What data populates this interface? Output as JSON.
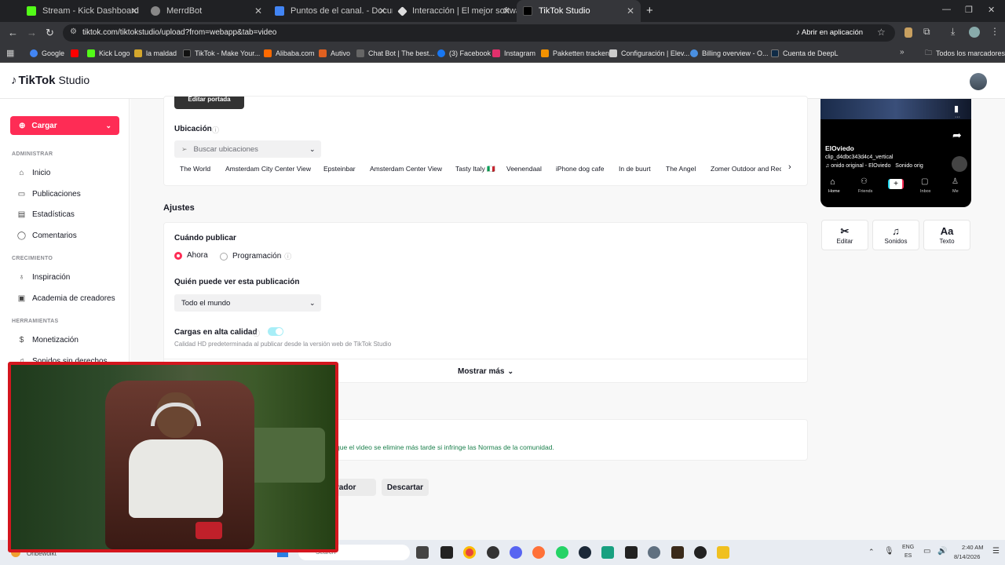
{
  "browser": {
    "tabs": [
      {
        "title": "Stream - Kick Dashboard",
        "color": "#53fc18"
      },
      {
        "title": "MerrdBot",
        "color": "#888888"
      },
      {
        "title": "Puntos de el canal. - Document",
        "color": "#4285f4"
      },
      {
        "title": "Interacción | El mejor software",
        "color": "#dddddd"
      },
      {
        "title": "TikTok Studio",
        "color": "#000000"
      }
    ],
    "new_tab": "+",
    "address": "tiktok.com/tiktokstudio/upload?from=webapp&tab=video",
    "open_in_app": "Abrir en aplicación",
    "bookmarks": [
      {
        "label": "Google",
        "color": "#4285f4"
      },
      {
        "label": "",
        "color": "#ff0000"
      },
      {
        "label": "Kick Logo",
        "color": "#53fc18"
      },
      {
        "label": "la maldad",
        "color": "#d4a72c"
      },
      {
        "label": "TikTok - Make Your...",
        "color": "#111111"
      },
      {
        "label": "Alibaba.com",
        "color": "#ff6a00"
      },
      {
        "label": "Autivo",
        "color": "#e06020"
      },
      {
        "label": "Chat Bot | The best...",
        "color": "#666666"
      },
      {
        "label": "(3) Facebook",
        "color": "#1877f2"
      },
      {
        "label": "Instagram",
        "color": "#e1306c"
      },
      {
        "label": "Pakketten tracken",
        "color": "#f39200"
      },
      {
        "label": "Configuración | Elev...",
        "color": "#cccccc"
      },
      {
        "label": "Billing overview - O...",
        "color": "#4a90e2"
      },
      {
        "label": "Cuenta de DeepL",
        "color": "#0f2b46"
      }
    ],
    "all_bookmarks": "Todos los marcadores"
  },
  "brand": {
    "logo_text": "TikTok",
    "studio": "Studio"
  },
  "sidebar": {
    "upload_button": "Cargar",
    "sections": [
      {
        "title": "ADMINISTRAR",
        "items": [
          {
            "label": "Inicio",
            "icon": "home-icon"
          },
          {
            "label": "Publicaciones",
            "icon": "posts-icon"
          },
          {
            "label": "Estadísticas",
            "icon": "analytics-icon"
          },
          {
            "label": "Comentarios",
            "icon": "comments-icon"
          }
        ]
      },
      {
        "title": "CRECIMIENTO",
        "items": [
          {
            "label": "Inspiración",
            "icon": "bulb-icon"
          },
          {
            "label": "Academia de creadores",
            "icon": "academy-icon"
          }
        ]
      },
      {
        "title": "HERRAMIENTAS",
        "items": [
          {
            "label": "Monetización",
            "icon": "money-icon"
          },
          {
            "label": "Sonidos sin derechos",
            "icon": "music-icon"
          }
        ]
      }
    ]
  },
  "upload": {
    "cover_button": "Editar portada",
    "location_label": "Ubicación",
    "location_placeholder": "Buscar ubicaciones",
    "location_chips": [
      "The World",
      "Amsterdam City Center View",
      "Epsteinbar",
      "Amsterdam Center View",
      "Tasty Italy 🇮🇹",
      "Veenendaal",
      "iPhone dog cafe",
      "In de buurt",
      "The Angel",
      "Zomer Outdoor and Rec"
    ],
    "settings_title": "Ajustes",
    "when_label": "Cuándo publicar",
    "when_options": [
      "Ahora",
      "Programación"
    ],
    "when_selected": "Ahora",
    "who_label": "Quién puede ver esta publicación",
    "who_value": "Todo el mundo",
    "hq_label": "Cargas en alta calidad",
    "hq_enabled": true,
    "hq_desc": "Calidad HD predeterminada al publicar desde la versión web de TikTok Studio",
    "show_more": "Mostrar más",
    "notice_text": "que el video se elimine más tarde si infringe las Normas de la comunidad.",
    "save_draft": "rrador",
    "discard": "Descartar"
  },
  "preview": {
    "username": "ElOviedo",
    "caption": "clip_d4dbc343d4c4_vertical",
    "sound": "onido original - ElOviedo   Sonido orig",
    "nav": [
      "Home",
      "Friends",
      "+",
      "Inbox",
      "Me"
    ]
  },
  "tools": [
    {
      "label": "Editar",
      "icon": "scissors-icon"
    },
    {
      "label": "Sonidos",
      "icon": "music-note-icon"
    },
    {
      "label": "Texto",
      "icon": "text-icon"
    }
  ],
  "taskbar": {
    "weather": "Onbewolkt",
    "search": "Search",
    "lang_top": "ENG",
    "lang_bottom": "ES",
    "time": "2:40 AM",
    "date": "8/14/2026"
  },
  "colors": {
    "accent": "#fe2c55",
    "teal": "#20d5ec"
  }
}
